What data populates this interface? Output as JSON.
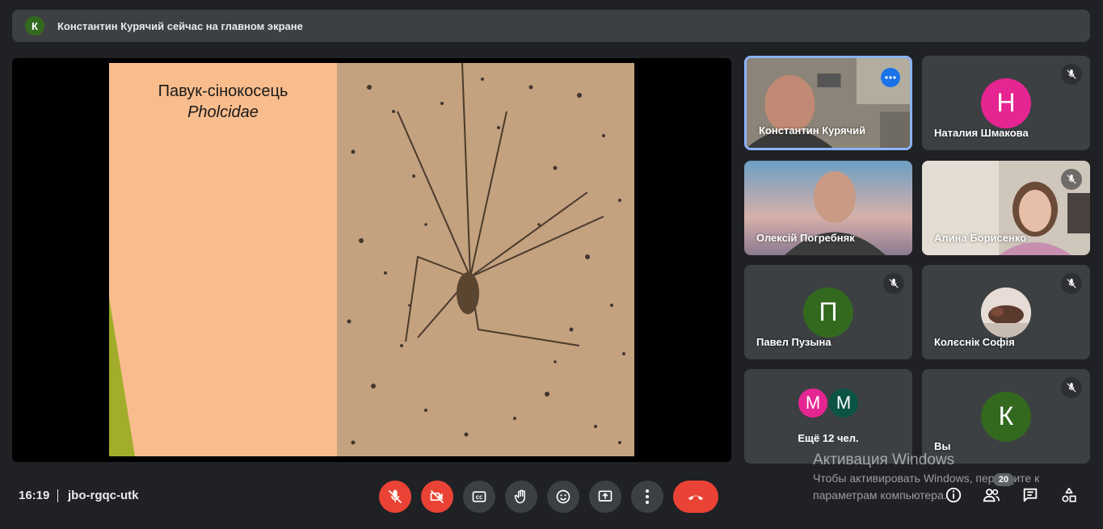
{
  "banner": {
    "avatar_letter": "К",
    "text": "Константин Курячий сейчас на главном экране"
  },
  "presentation": {
    "title": "Павук-сінокосець",
    "subtitle": "Pholcidae"
  },
  "participants": [
    {
      "name": "Константин Курячий",
      "type": "video",
      "active": true
    },
    {
      "name": "Наталия Шмакова",
      "type": "avatar",
      "letter": "Н",
      "color": "#e52592",
      "muted": true
    },
    {
      "name": "Олексій Погребняк",
      "type": "video"
    },
    {
      "name": "Алина Борисенко",
      "type": "video",
      "muted": true
    },
    {
      "name": "Павел Пузына",
      "type": "avatar",
      "letter": "П",
      "color": "#33691e",
      "muted": true
    },
    {
      "name": "Колєснік Софія",
      "type": "photo",
      "muted": true
    },
    {
      "name": "Вы",
      "type": "avatar",
      "letter": "К",
      "color": "#33691e",
      "muted": true
    }
  ],
  "more": {
    "label": "Ещё 12 чел.",
    "letters": [
      "М",
      "М"
    ],
    "colors": [
      "#e52592",
      "#0b5345"
    ]
  },
  "meeting": {
    "time": "16:19",
    "code": "jbo-rgqc-utk",
    "participant_count": "20"
  },
  "controls": [
    "mic-off",
    "camera-off",
    "captions",
    "raise-hand",
    "emoji",
    "present",
    "more-options",
    "leave-call"
  ],
  "watermark": {
    "title": "Активация Windows",
    "text": "Чтобы активировать Windows, перейдите к параметрам компьютера."
  },
  "colors": {
    "accent": "#8ab4f8",
    "danger": "#ea4335",
    "surface": "#3c4043",
    "background": "#202124"
  }
}
